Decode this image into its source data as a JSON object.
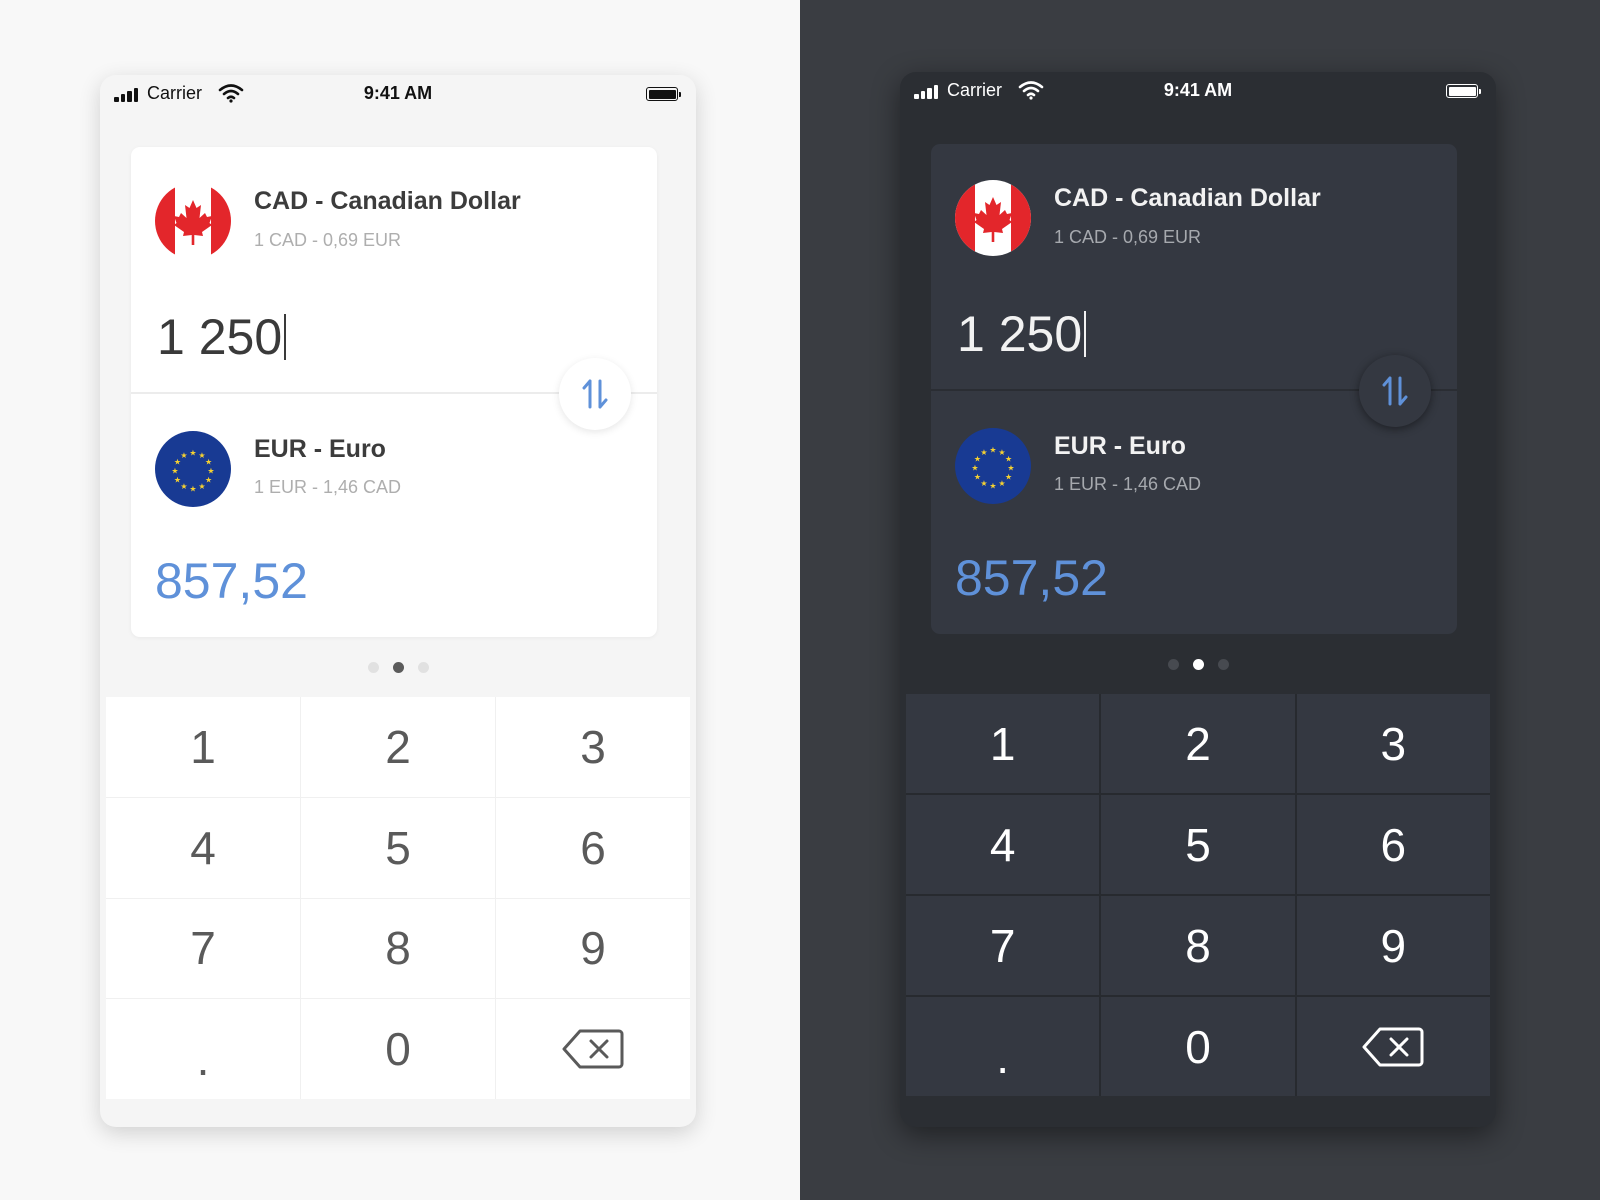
{
  "status_bar": {
    "carrier": "Carrier",
    "time": "9:41 AM"
  },
  "from_currency": {
    "flag": "canada-flag",
    "name": "CAD - Canadian Dollar",
    "rate": "1 CAD - 0,69 EUR",
    "amount": "1 250"
  },
  "to_currency": {
    "flag": "eu-flag",
    "name": "EUR - Euro",
    "rate": "1 EUR - 1,46 CAD",
    "amount": "857,52"
  },
  "swap_icon": "swap-vertical-icon",
  "pager": {
    "count": 3,
    "active": 2
  },
  "keypad": {
    "keys": [
      "1",
      "2",
      "3",
      "4",
      "5",
      "6",
      "7",
      "8",
      "9",
      ".",
      "0"
    ],
    "backspace_icon": "backspace-icon"
  },
  "colors": {
    "accent": "#5f91d9",
    "light_background": "#f8f8f8",
    "dark_background": "#3a3d42",
    "dark_card": "#343841",
    "canada_red": "#e3262b",
    "eu_blue": "#183a93",
    "eu_gold": "#f6d131"
  }
}
